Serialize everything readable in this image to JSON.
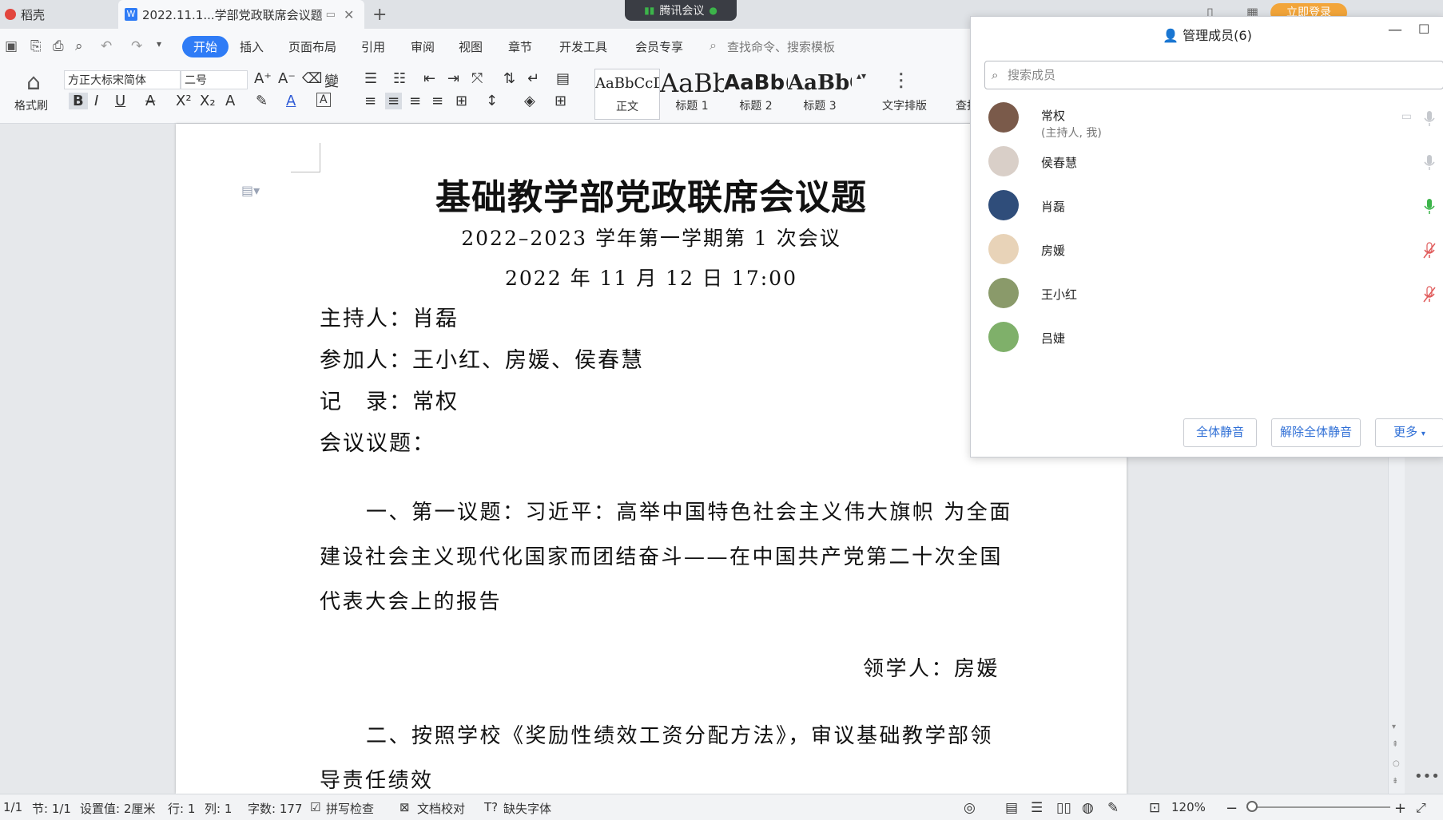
{
  "tabs": [
    {
      "label": "稻壳"
    },
    {
      "label": "2022.11.1...学部党政联席会议题"
    }
  ],
  "meeting_pill": "腾讯会议",
  "login_label": "立即登录",
  "menu": [
    "开始",
    "插入",
    "页面布局",
    "引用",
    "审阅",
    "视图",
    "章节",
    "开发工具",
    "会员专享"
  ],
  "command_search": "查找命令、搜索模板",
  "ribbon": {
    "format_painter": "格式刷",
    "font_name": "方正大标宋简体",
    "font_size": "二号",
    "styles": [
      {
        "sample": "AaBbCcDd",
        "label": "正文"
      },
      {
        "sample": "AaBb",
        "label": "标题 1"
      },
      {
        "sample": "AaBb(",
        "label": "标题 2"
      },
      {
        "sample": "AaBbC",
        "label": "标题 3"
      }
    ],
    "text_layout": "文字排版",
    "find": "查找"
  },
  "document": {
    "title": "基础教学部党政联席会议题",
    "subtitle": "2022–2023 学年第一学期第 1 次会议",
    "date": "2022 年 11 月 12 日 17:00",
    "host": "主持人：肖磊",
    "participants": "参加人：王小红、房媛、侯春慧",
    "recorder": "记　录：常权",
    "agenda_heading": "会议议题：",
    "item1_lines": [
      "一、第一议题：习近平：高举中国特色社会主义伟大旗帜 为全面",
      "建设社会主义现代化国家而团结奋斗——在中国共产党第二十次全国",
      "代表大会上的报告"
    ],
    "item1_lead": "领学人：房媛",
    "item2_lines": [
      "二、按照学校《奖励性绩效工资分配方法》，审议基础教学部领",
      "导责任绩效"
    ]
  },
  "panel": {
    "title": "管理成员(6)",
    "search_placeholder": "搜索成员",
    "members": [
      {
        "name": "常权",
        "note": "(主持人, 我)",
        "mic": "off-grey",
        "avatar_color": "#7a5a4a"
      },
      {
        "name": "侯春慧",
        "note": "",
        "mic": "grey",
        "avatar_color": "#d9cfc8"
      },
      {
        "name": "肖磊",
        "note": "",
        "mic": "green",
        "avatar_color": "#2f4d7a"
      },
      {
        "name": "房媛",
        "note": "",
        "mic": "muted-red",
        "avatar_color": "#e8d3b8"
      },
      {
        "name": "王小红",
        "note": "",
        "mic": "muted-red",
        "avatar_color": "#8a9a6a"
      },
      {
        "name": "吕婕",
        "note": "",
        "mic": "none",
        "avatar_color": "#7fb06a"
      }
    ],
    "buttons": {
      "mute_all": "全体静音",
      "unmute_all": "解除全体静音",
      "more": "更多"
    }
  },
  "status": {
    "page": "1/1",
    "section": "节: 1/1",
    "setting": "设置值: 2厘米",
    "row": "行: 1",
    "col": "列: 1",
    "words": "字数: 177",
    "spell": "拼写检查",
    "proof": "文档校对",
    "missing_font": "缺失字体",
    "zoom": "120%"
  },
  "colors": {
    "accent": "#2f7cf6",
    "mic_green": "#3cb44a",
    "mic_red": "#e05a5a"
  }
}
